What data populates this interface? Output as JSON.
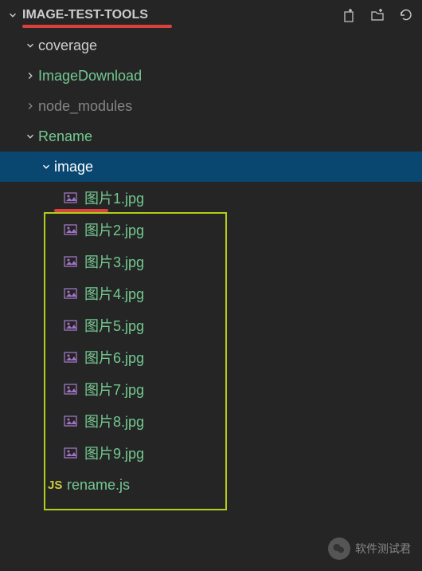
{
  "project": {
    "title": "IMAGE-TEST-TOOLS"
  },
  "tree": {
    "coverage": "coverage",
    "imageDownload": "ImageDownload",
    "nodeModules": "node_modules",
    "rename": "Rename",
    "image": "image",
    "renameJs": "rename.js"
  },
  "files": [
    "图片1.jpg",
    "图片2.jpg",
    "图片3.jpg",
    "图片4.jpg",
    "图片5.jpg",
    "图片6.jpg",
    "图片7.jpg",
    "图片8.jpg",
    "图片9.jpg"
  ],
  "watermark": "软件测试君"
}
